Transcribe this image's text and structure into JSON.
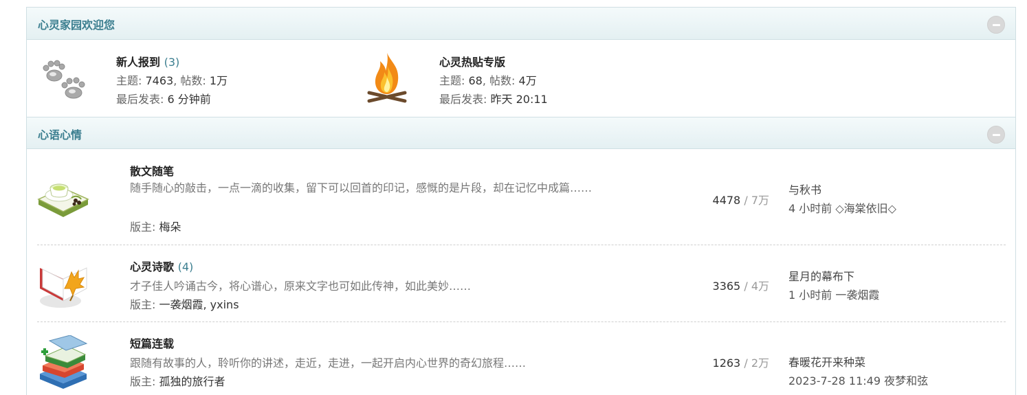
{
  "categories": [
    {
      "title": "心灵家园欢迎您",
      "forums": [
        {
          "name": "新人报到",
          "today": "(3)",
          "topics_label": "主题:",
          "topics": "7463",
          "posts_label": "帖数:",
          "posts": "1万",
          "last_label": "最后发表:",
          "last": "6 分钟前",
          "icon": "paw-prints-icon"
        },
        {
          "name": "心灵热贴专版",
          "topics_label": "主题:",
          "topics": "68",
          "posts_label": "帖数:",
          "posts": "4万",
          "last_label": "最后发表:",
          "last": "昨天 20:11",
          "icon": "campfire-icon"
        }
      ]
    },
    {
      "title": "心语心情",
      "forums": [
        {
          "name": "散文随笔",
          "desc": "随手随心的敲击，一点一滴的收集，留下可以回首的印记，感慨的是片段，却在记忆中成篇……",
          "mod_label": "版主:",
          "mods": "梅朵",
          "threads": "4478",
          "posts": "7万",
          "last_title": "与秋书",
          "last_time": "4 小时前",
          "last_user": "◇海棠依旧◇",
          "icon": "tea-book-icon"
        },
        {
          "name": "心灵诗歌",
          "today": "(4)",
          "desc": "才子佳人吟诵古今，将心谱心，原来文字也可如此传神，如此美妙……",
          "mod_label": "版主:",
          "mods": "一袭烟霞, yxins",
          "threads": "3365",
          "posts": "4万",
          "last_title": "星月的幕布下",
          "last_time": "1 小时前",
          "last_user": "一袭烟霞",
          "icon": "leaf-book-icon"
        },
        {
          "name": "短篇连载",
          "desc": "跟随有故事的人，聆听你的讲述，走近，走进，一起开启内心世界的奇幻旅程……",
          "mod_label": "版主:",
          "mods": "孤独的旅行者",
          "threads": "1263",
          "posts": "2万",
          "last_title": "春暖花开来种菜",
          "last_time": "2023-7-28 11:49",
          "last_user": "夜梦和弦",
          "icon": "book-stack-icon"
        }
      ]
    }
  ],
  "stat_separator": "/"
}
